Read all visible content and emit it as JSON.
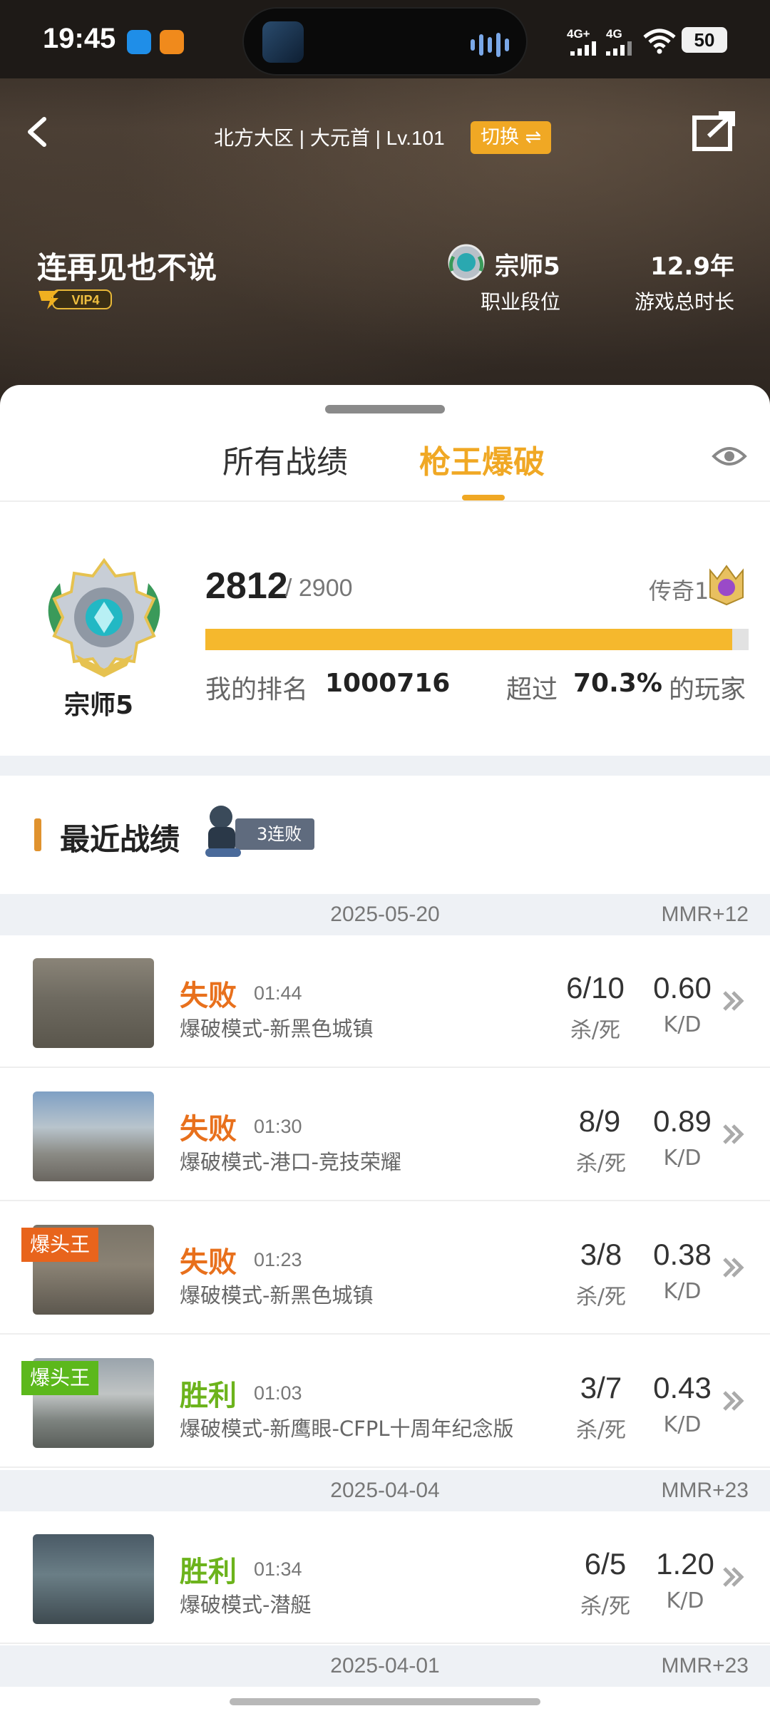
{
  "status_bar": {
    "time": "19:45",
    "signal_1": "4G+",
    "signal_2": "4G",
    "battery": "50"
  },
  "header": {
    "server": "北方大区 | 大元首 | Lv.101",
    "switch_label": "切换 ⇌",
    "nickname": "连再见也不说",
    "vip_label": "VIP4",
    "rank_name": "宗师5",
    "rank_caption": "职业段位",
    "duration": "12.9年",
    "duration_caption": "游戏总时长"
  },
  "tabs": {
    "all": "所有战绩",
    "active": "枪王爆破"
  },
  "rank_card": {
    "badge_name": "宗师5",
    "score": "2812",
    "score_max": "/ 2900",
    "next_rank": "传奇1",
    "progress": 0.97,
    "my_rank_label": "我的排名",
    "my_rank_value": "1000716",
    "exceed_label": "超过",
    "exceed_value": "70.3%",
    "exceed_suffix": "的玩家"
  },
  "recent": {
    "title": "最近战绩",
    "streak": "3连败",
    "kd_caption_kills": "杀/死",
    "kd_caption_ratio": "K/D",
    "groups": [
      {
        "date": "2025-05-20",
        "mmr": "MMR+12",
        "matches": [
          {
            "result": "失败",
            "duration": "01:44",
            "mode": "爆破模式-新黑色城镇",
            "kills": "6/10",
            "kd": "0.60",
            "tag": ""
          },
          {
            "result": "失败",
            "duration": "01:30",
            "mode": "爆破模式-港口-竞技荣耀",
            "kills": "8/9",
            "kd": "0.89",
            "tag": ""
          },
          {
            "result": "失败",
            "duration": "01:23",
            "mode": "爆破模式-新黑色城镇",
            "kills": "3/8",
            "kd": "0.38",
            "tag": "爆头王"
          },
          {
            "result": "胜利",
            "duration": "01:03",
            "mode": "爆破模式-新鹰眼-CFPL十周年纪念版",
            "kills": "3/7",
            "kd": "0.43",
            "tag": "爆头王"
          }
        ]
      },
      {
        "date": "2025-04-04",
        "mmr": "MMR+23",
        "matches": [
          {
            "result": "胜利",
            "duration": "01:34",
            "mode": "爆破模式-潜艇",
            "kills": "6/5",
            "kd": "1.20",
            "tag": ""
          }
        ]
      },
      {
        "date": "2025-04-01",
        "mmr": "MMR+23",
        "matches": []
      }
    ]
  },
  "colors": {
    "accent": "#f0a824",
    "loss": "#e8701c",
    "win": "#6cb31c",
    "tag_loss_bg": "#e8641c",
    "tag_win_bg": "#5cb81c"
  }
}
